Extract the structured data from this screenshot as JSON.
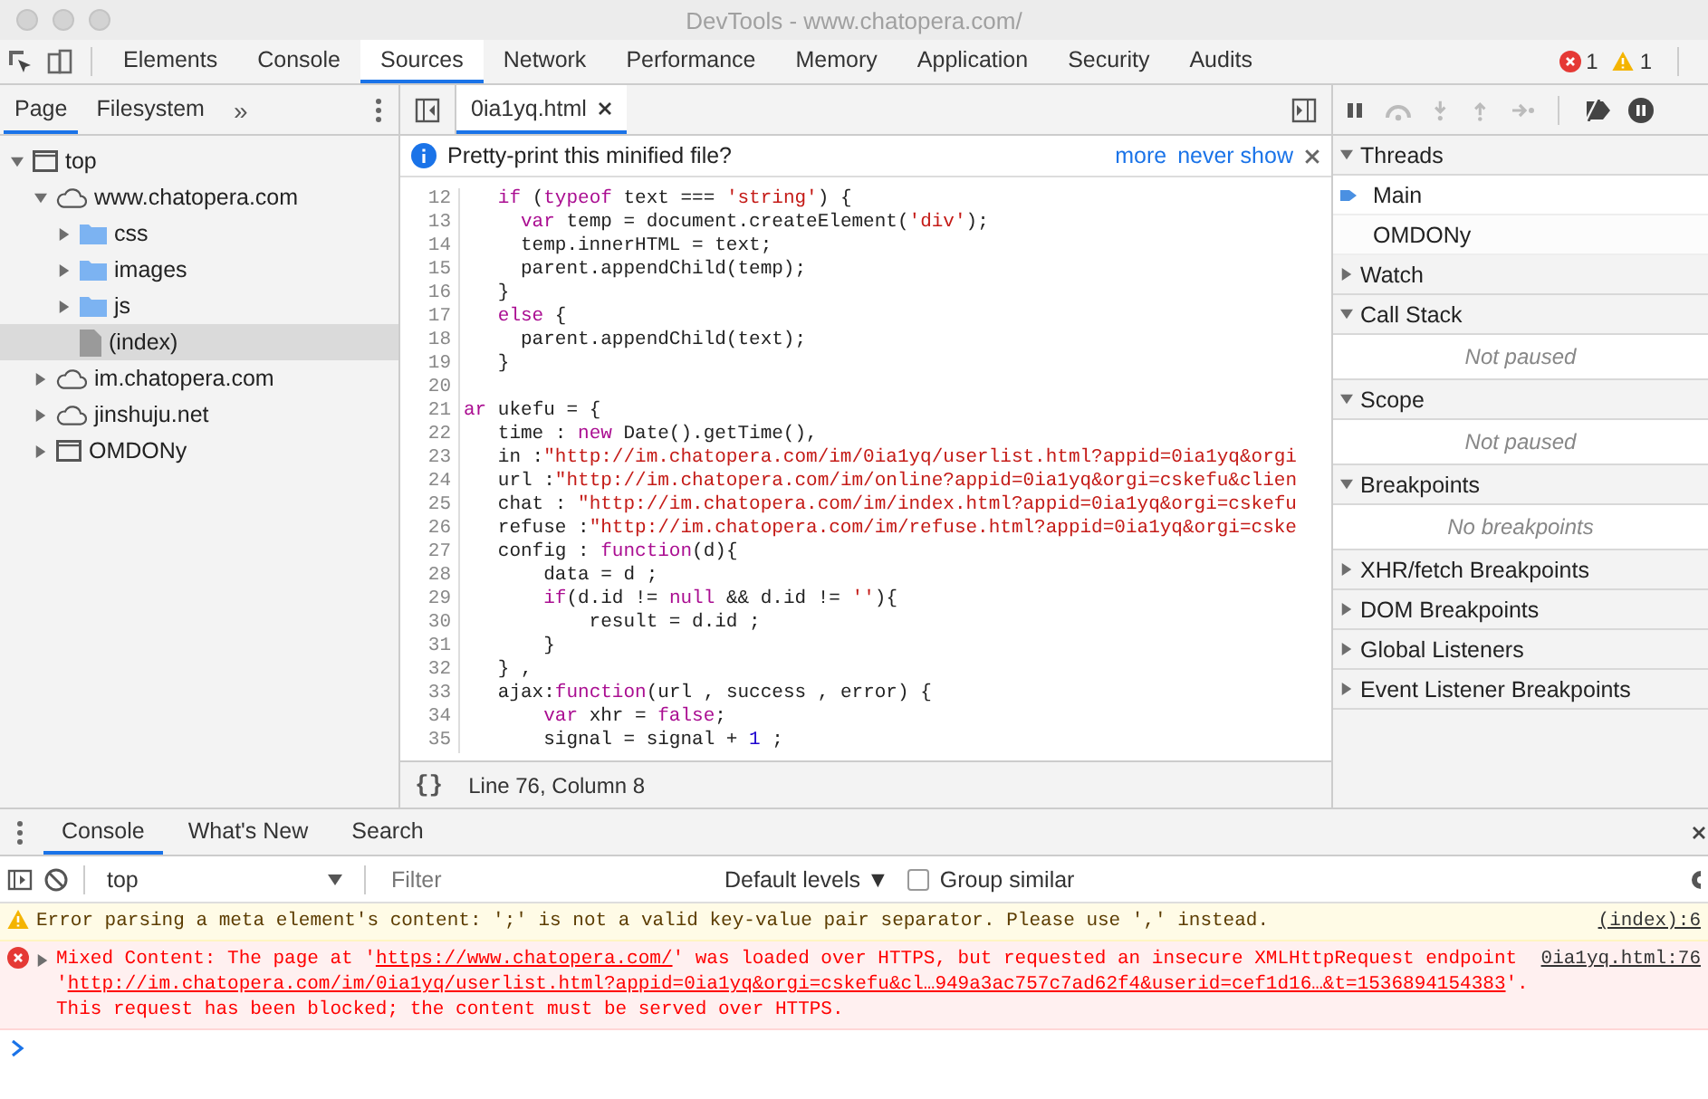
{
  "window": {
    "title": "DevTools - www.chatopera.com/"
  },
  "main_tabs": [
    {
      "label": "Elements",
      "selected": false
    },
    {
      "label": "Console",
      "selected": false
    },
    {
      "label": "Sources",
      "selected": true
    },
    {
      "label": "Network",
      "selected": false
    },
    {
      "label": "Performance",
      "selected": false
    },
    {
      "label": "Memory",
      "selected": false
    },
    {
      "label": "Application",
      "selected": false
    },
    {
      "label": "Security",
      "selected": false
    },
    {
      "label": "Audits",
      "selected": false
    }
  ],
  "counters": {
    "errors": "1",
    "warnings": "1"
  },
  "navigator": {
    "tabs": [
      {
        "label": "Page",
        "selected": true
      },
      {
        "label": "Filesystem",
        "selected": false
      }
    ],
    "more": "»",
    "tree": [
      {
        "label": "top",
        "kind": "frame",
        "expanded": true,
        "selected": false,
        "children": [
          {
            "label": "www.chatopera.com",
            "kind": "cloud",
            "expanded": true,
            "selected": false,
            "children": [
              {
                "label": "css",
                "kind": "folder",
                "expanded": false,
                "selected": false
              },
              {
                "label": "images",
                "kind": "folder",
                "expanded": false,
                "selected": false
              },
              {
                "label": "js",
                "kind": "folder",
                "expanded": false,
                "selected": false
              },
              {
                "label": "(index)",
                "kind": "file",
                "selected": true
              }
            ]
          },
          {
            "label": "im.chatopera.com",
            "kind": "cloud",
            "expanded": false,
            "selected": false
          },
          {
            "label": "jinshuju.net",
            "kind": "cloud",
            "expanded": false,
            "selected": false
          },
          {
            "label": "OMDONy",
            "kind": "frame",
            "expanded": false,
            "selected": false
          }
        ]
      }
    ]
  },
  "editor": {
    "tabs": [
      {
        "label": "0ia1yq.html",
        "selected": true
      }
    ],
    "infobar": {
      "text": "Pretty-print this minified file?",
      "links": [
        "more",
        "never show"
      ]
    },
    "lines": [
      {
        "number": "12",
        "tokens": [
          {
            "kind": "keyword",
            "text": "   if"
          },
          {
            "kind": "plain",
            "text": " ("
          },
          {
            "kind": "keyword",
            "text": "typeof"
          },
          {
            "kind": "plain",
            "text": " text === "
          },
          {
            "kind": "string",
            "text": "'string'"
          },
          {
            "kind": "plain",
            "text": ") {"
          }
        ]
      },
      {
        "number": "13",
        "tokens": [
          {
            "kind": "keyword",
            "text": "     var"
          },
          {
            "kind": "plain",
            "text": " temp = document.createElement("
          },
          {
            "kind": "string",
            "text": "'div'"
          },
          {
            "kind": "plain",
            "text": ");"
          }
        ]
      },
      {
        "number": "14",
        "tokens": [
          {
            "kind": "plain",
            "text": "     temp.innerHTML = text;"
          }
        ]
      },
      {
        "number": "15",
        "tokens": [
          {
            "kind": "plain",
            "text": "     parent.appendChild(temp);"
          }
        ]
      },
      {
        "number": "16",
        "tokens": [
          {
            "kind": "plain",
            "text": "   }"
          }
        ]
      },
      {
        "number": "17",
        "tokens": [
          {
            "kind": "keyword",
            "text": "   else"
          },
          {
            "kind": "plain",
            "text": " {"
          }
        ]
      },
      {
        "number": "18",
        "tokens": [
          {
            "kind": "plain",
            "text": "     parent.appendChild(text);"
          }
        ]
      },
      {
        "number": "19",
        "tokens": [
          {
            "kind": "plain",
            "text": "   }"
          }
        ]
      },
      {
        "number": "20"
      },
      {
        "number": "21",
        "tokens": [
          {
            "kind": "keyword",
            "text": "ar"
          },
          {
            "kind": "plain",
            "text": " ukefu = {"
          }
        ]
      },
      {
        "number": "22",
        "tokens": [
          {
            "kind": "plain",
            "text": "   time : "
          },
          {
            "kind": "keyword",
            "text": "new"
          },
          {
            "kind": "plain",
            "text": " Date().getTime(),"
          }
        ]
      },
      {
        "number": "23",
        "tokens": [
          {
            "kind": "plain",
            "text": "   in :"
          },
          {
            "kind": "string",
            "text": "\"http://im.chatopera.com/im/0ia1yq/userlist.html?appid=0ia1yq&orgi"
          }
        ]
      },
      {
        "number": "24",
        "tokens": [
          {
            "kind": "plain",
            "text": "   url :"
          },
          {
            "kind": "string",
            "text": "\"http://im.chatopera.com/im/online?appid=0ia1yq&orgi=cskefu&clien"
          }
        ]
      },
      {
        "number": "25",
        "tokens": [
          {
            "kind": "plain",
            "text": "   chat : "
          },
          {
            "kind": "string",
            "text": "\"http://im.chatopera.com/im/index.html?appid=0ia1yq&orgi=cskefu"
          }
        ]
      },
      {
        "number": "26",
        "tokens": [
          {
            "kind": "plain",
            "text": "   refuse :"
          },
          {
            "kind": "string",
            "text": "\"http://im.chatopera.com/im/refuse.html?appid=0ia1yq&orgi=cske"
          }
        ]
      },
      {
        "number": "27",
        "tokens": [
          {
            "kind": "plain",
            "text": "   config : "
          },
          {
            "kind": "keyword",
            "text": "function"
          },
          {
            "kind": "plain",
            "text": "(d){"
          }
        ]
      },
      {
        "number": "28",
        "tokens": [
          {
            "kind": "plain",
            "text": "       data = d ;"
          }
        ]
      },
      {
        "number": "29",
        "tokens": [
          {
            "kind": "keyword",
            "text": "       if"
          },
          {
            "kind": "plain",
            "text": "(d.id != "
          },
          {
            "kind": "keyword",
            "text": "null"
          },
          {
            "kind": "plain",
            "text": " && d.id != "
          },
          {
            "kind": "string",
            "text": "''"
          },
          {
            "kind": "plain",
            "text": "){"
          }
        ]
      },
      {
        "number": "30",
        "tokens": [
          {
            "kind": "plain",
            "text": "           result = d.id ;"
          }
        ]
      },
      {
        "number": "31",
        "tokens": [
          {
            "kind": "plain",
            "text": "       }"
          }
        ]
      },
      {
        "number": "32",
        "tokens": [
          {
            "kind": "plain",
            "text": "   } ,"
          }
        ]
      },
      {
        "number": "33",
        "tokens": [
          {
            "kind": "plain",
            "text": "   ajax:"
          },
          {
            "kind": "keyword",
            "text": "function"
          },
          {
            "kind": "plain",
            "text": "(url , success , error) {"
          }
        ]
      },
      {
        "number": "34",
        "tokens": [
          {
            "kind": "keyword",
            "text": "       var"
          },
          {
            "kind": "plain",
            "text": " xhr = "
          },
          {
            "kind": "keyword",
            "text": "false"
          },
          {
            "kind": "plain",
            "text": ";"
          }
        ]
      },
      {
        "number": "35",
        "tokens": [
          {
            "kind": "plain",
            "text": "       signal = signal + "
          },
          {
            "kind": "number",
            "text": "1"
          },
          {
            "kind": "plain",
            "text": " ;"
          }
        ]
      }
    ],
    "format_button": "{}",
    "status": "Line 76, Column 8"
  },
  "debugger": {
    "sections": [
      {
        "title": "Threads",
        "expanded": true,
        "items": [
          {
            "label": "Main",
            "selected": true
          },
          {
            "label": "OMDONy",
            "selected": false
          }
        ]
      },
      {
        "title": "Watch",
        "expanded": false
      },
      {
        "title": "Call Stack",
        "expanded": true,
        "message": "Not paused"
      },
      {
        "title": "Scope",
        "expanded": true,
        "message": "Not paused"
      },
      {
        "title": "Breakpoints",
        "expanded": true,
        "message": "No breakpoints"
      },
      {
        "title": "XHR/fetch Breakpoints",
        "expanded": false
      },
      {
        "title": "DOM Breakpoints",
        "expanded": false
      },
      {
        "title": "Global Listeners",
        "expanded": false
      },
      {
        "title": "Event Listener Breakpoints",
        "expanded": false
      }
    ]
  },
  "drawer": {
    "tabs": [
      {
        "label": "Console",
        "selected": true
      },
      {
        "label": "What's New",
        "selected": false
      },
      {
        "label": "Search",
        "selected": false
      }
    ],
    "context": "top",
    "filter": {
      "placeholder": "Filter"
    },
    "levels": "Default levels ▼",
    "group_similar": {
      "label": "Group similar",
      "checked": false
    },
    "messages": [
      {
        "kind": "warning",
        "segments": [
          {
            "kind": "text",
            "text": "Error parsing a meta element's content: ';' is not a valid key-value pair separator. Please use ',' instead."
          }
        ],
        "source": "(index):6"
      },
      {
        "kind": "error",
        "expanded": false,
        "segments": [
          {
            "kind": "text",
            "text": "Mixed Content: The page at '"
          },
          {
            "kind": "link",
            "text": "https://www.chatopera.com/"
          },
          {
            "kind": "text",
            "text": "' was loaded over HTTPS, but requested an insecure XMLHttpRequest endpoint '"
          },
          {
            "kind": "link",
            "text": "http://im.chatopera.com/im/0ia1yq/userlist.html?appid=0ia1yq&orgi=cskefu&cl…949a3ac757c7ad62f4&userid=cef1d16…&t=1536894154383"
          },
          {
            "kind": "text",
            "text": "'. This request has been blocked; the content must be served over HTTPS."
          }
        ],
        "source": "0ia1yq.html:76"
      }
    ]
  }
}
